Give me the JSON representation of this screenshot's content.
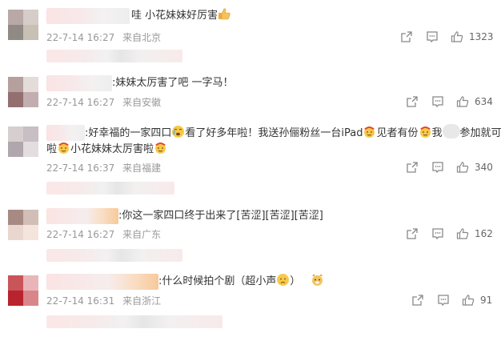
{
  "comments": [
    {
      "text": "哇 小花妹妹好厉害",
      "time": "22-7-14 16:27",
      "location": "来自北京",
      "likes": "1323"
    },
    {
      "text": ":妹妹太厉害了吧 一字马！",
      "time": "22-7-14 16:27",
      "location": "来自安徽",
      "likes": "634"
    },
    {
      "text_line1_a": ":好幸福的一家四口",
      "text_line1_b": "看了好多年啦！我送孙俪粉丝一台iPad",
      "text_line1_c": "见者有份",
      "text_line1_d": "我",
      "text_line1_e": "参加就可以",
      "text_line2_a": "啦",
      "text_line2_b": "小花妹妹太厉害啦",
      "time": "22-7-14 16:37",
      "location": "来自福建",
      "likes": "340"
    },
    {
      "text": ":你这一家四口终于出来了[苦涩][苦涩][苦涩]",
      "time": "22-7-14 16:27",
      "location": "来自广东",
      "likes": "162"
    },
    {
      "text_a": ":什么时候拍个剧（超小声",
      "text_b": "）",
      "time": "22-7-14 16:31",
      "location": "来自浙江",
      "likes": "91"
    }
  ],
  "icons": {
    "share": "share-icon",
    "comment": "comment-icon",
    "like": "like-icon"
  }
}
